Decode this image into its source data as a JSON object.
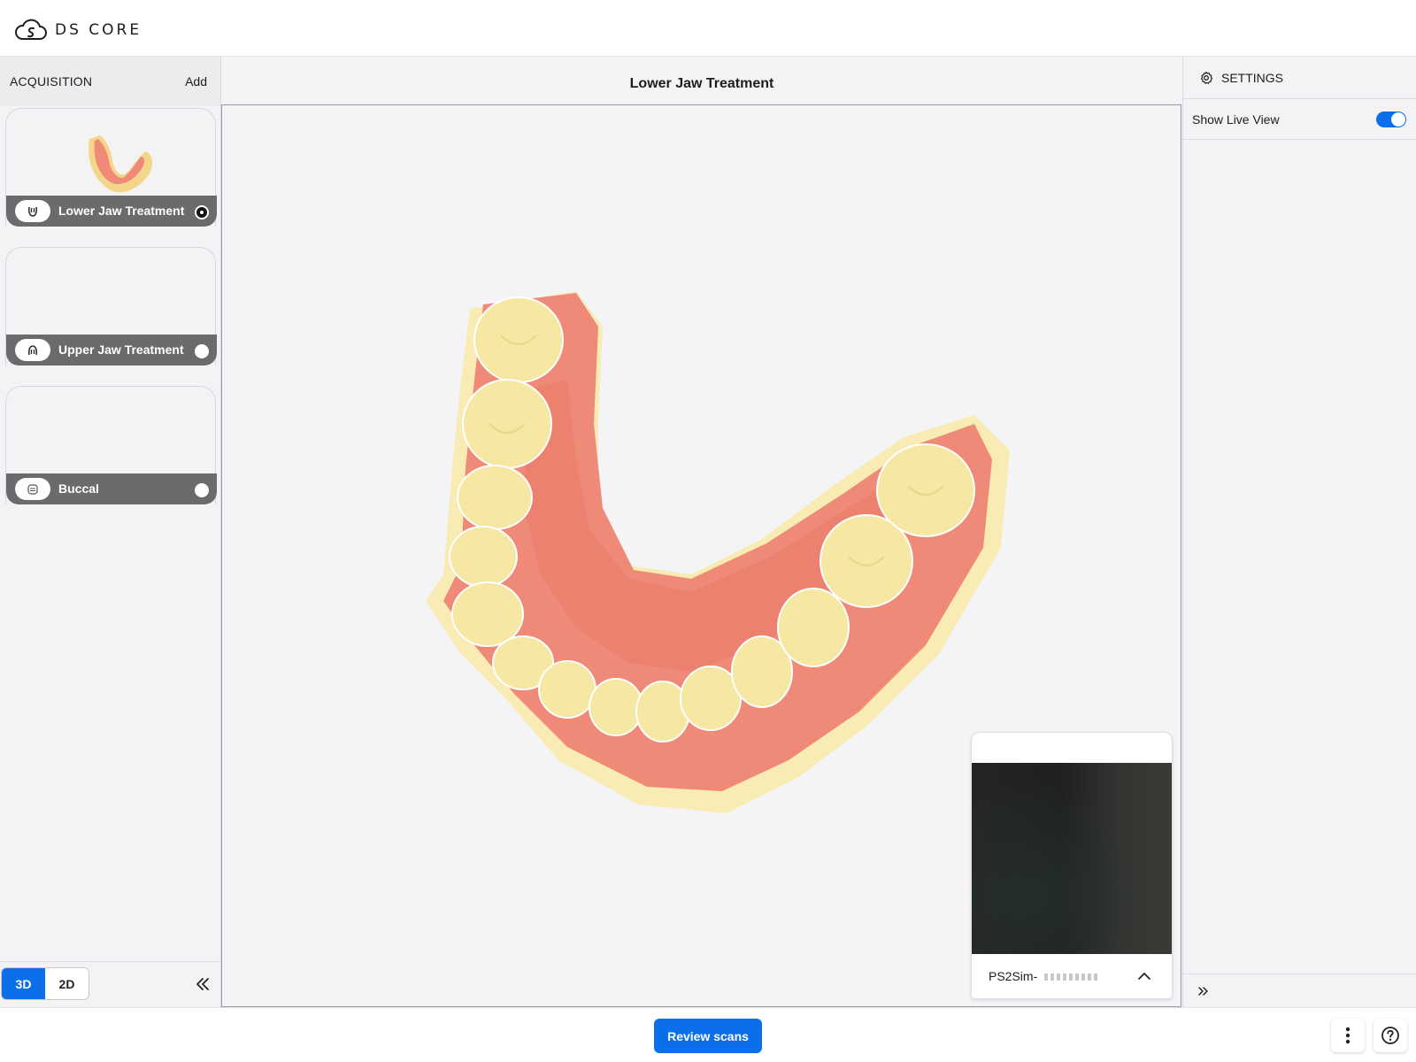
{
  "app": {
    "logo_text": "DS CORE"
  },
  "left_panel": {
    "title": "ACQUISITION",
    "add_label": "Add",
    "cards": [
      {
        "label": "Lower Jaw Treatment",
        "icon": "lower-jaw-icon",
        "selected": true,
        "has_thumbnail": true
      },
      {
        "label": "Upper Jaw Treatment",
        "icon": "upper-jaw-icon",
        "selected": false,
        "has_thumbnail": false
      },
      {
        "label": "Buccal",
        "icon": "buccal-icon",
        "selected": false,
        "has_thumbnail": false
      }
    ],
    "view_modes": [
      "3D",
      "2D"
    ],
    "active_view_mode": "3D"
  },
  "main": {
    "title": "Lower Jaw Treatment",
    "live_view": {
      "device_name": "PS2Sim-"
    }
  },
  "settings": {
    "title": "SETTINGS",
    "show_live_view_label": "Show Live View",
    "show_live_view_enabled": true
  },
  "footer": {
    "review_label": "Review scans"
  },
  "colors": {
    "accent": "#0a6fe8",
    "card_bar": "#6b6b6e",
    "gum": "#ef8a78",
    "tooth": "#f6e7a3"
  }
}
